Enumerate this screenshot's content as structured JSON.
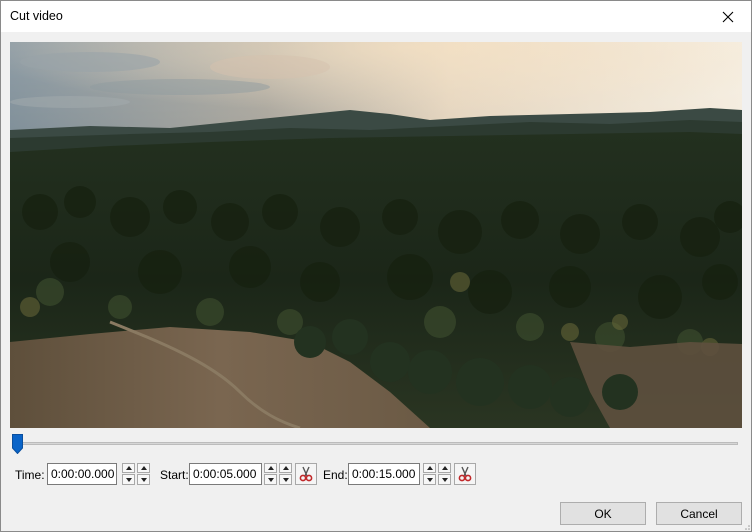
{
  "dialog": {
    "title": "Cut video",
    "close_icon": "close-icon"
  },
  "video": {
    "description_icon": "video-preview",
    "position_fraction": 0.0
  },
  "controls": {
    "time_label": "Time:",
    "time_value": "0:00:00.000",
    "start_label": "Start:",
    "start_value": "0:00:05.000",
    "end_label": "End:",
    "end_value": "0:00:15.000",
    "cut_icon": "scissors-icon"
  },
  "buttons": {
    "ok_label": "OK",
    "cancel_label": "Cancel"
  },
  "colors": {
    "accent": "#0a64c8",
    "scissors": "#c0282a"
  }
}
